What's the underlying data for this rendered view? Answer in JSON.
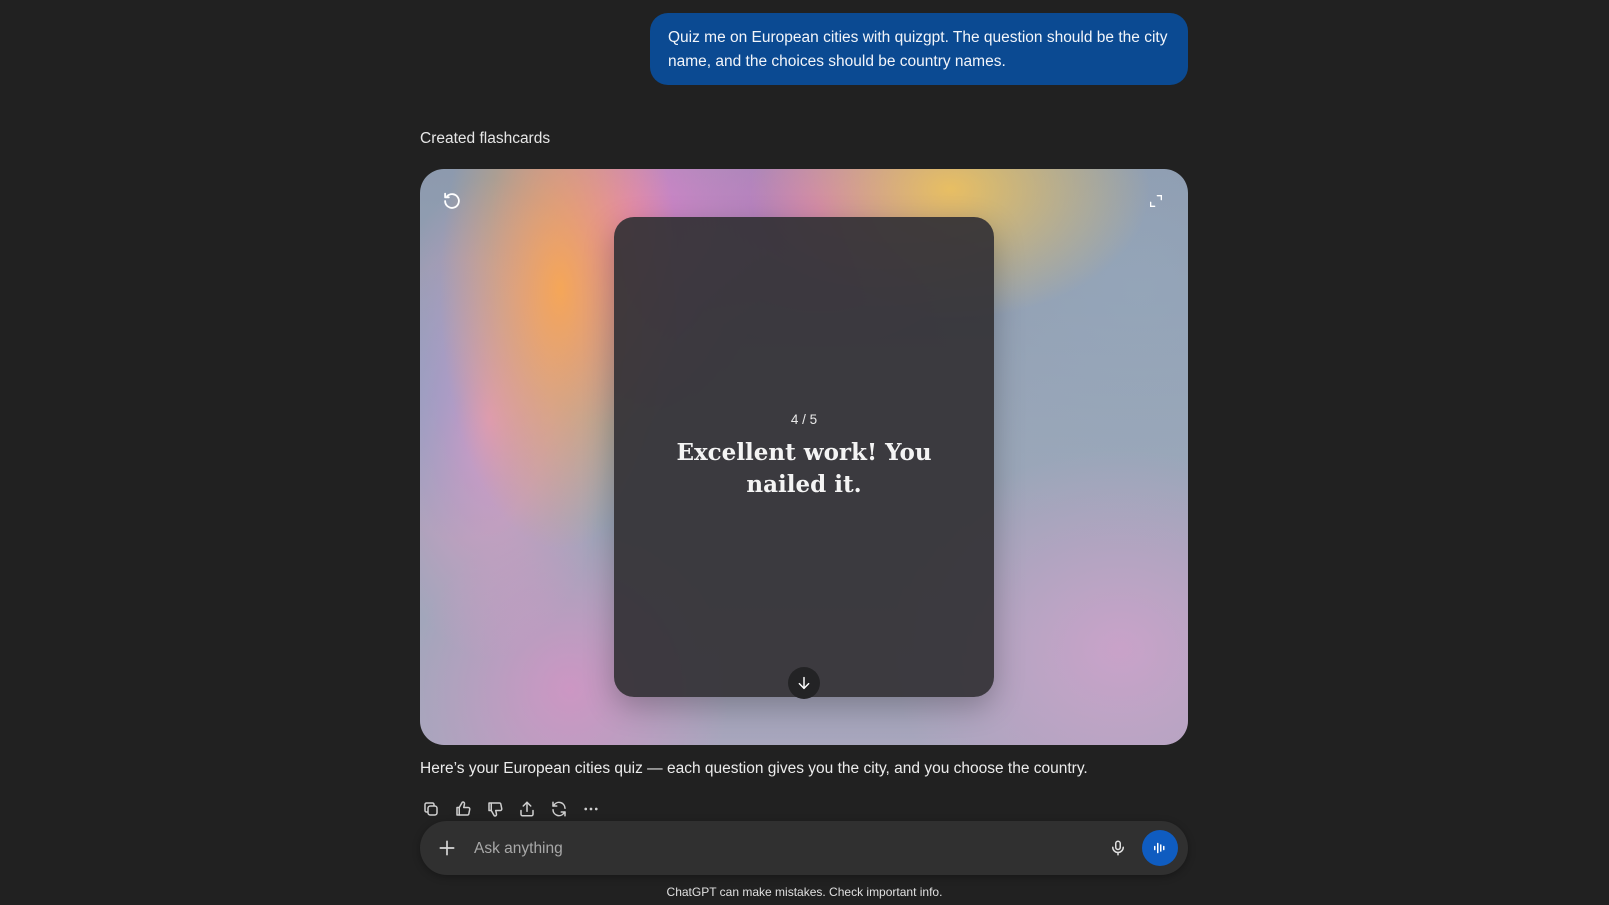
{
  "conversation": {
    "user_message": "Quiz me on European cities with quizgpt. The question should be the city name, and the choices should be country names.",
    "status": "Created flashcards",
    "assistant_reply": "Here’s your European cities quiz — each question gives you the city, and you choose the country."
  },
  "flashcards": {
    "counter": "4 / 5",
    "card_text": "Excellent work! You nailed it.",
    "icons": {
      "restart": "restart-icon",
      "expand": "expand-icon",
      "flip": "arrow-down-icon"
    }
  },
  "message_actions": {
    "icons": [
      "copy-icon",
      "thumbs-up-icon",
      "thumbs-down-icon",
      "share-icon",
      "regenerate-icon",
      "more-icon"
    ]
  },
  "composer": {
    "placeholder": "Ask anything",
    "value": "",
    "icons": {
      "add": "plus-icon",
      "mic": "mic-icon",
      "voice": "voice-mode-icon"
    },
    "accent_color": "#0f5cc0"
  },
  "footer": {
    "disclaimer": "ChatGPT can make mistakes. Check important info."
  },
  "colors": {
    "background": "#212121",
    "user_bubble": "#0b4a92",
    "card": "#343236"
  }
}
